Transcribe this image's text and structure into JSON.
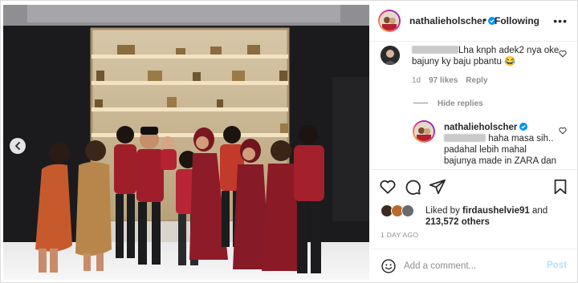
{
  "post": {
    "username": "nathalieholscher",
    "follow_separator": "•",
    "follow_label": "Following",
    "more_label": "•••"
  },
  "comments": [
    {
      "text": "Lha knph adek2 nya oke bajuny ky baju pbantu 😂",
      "meta": {
        "time": "1d",
        "likes": "97 likes",
        "reply": "Reply"
      }
    }
  ],
  "hide_replies_label": "Hide replies",
  "reply": {
    "username": "nathalieholscher",
    "text": "haha masa sih.. padahal lebih mahal bajunya made in ZARA dan"
  },
  "likes": {
    "prefix": "Liked by",
    "user": "firdaushelvie91",
    "and": "and",
    "count": "213,572 others"
  },
  "date": "1 DAY AGO",
  "add_comment": {
    "placeholder": "Add a comment...",
    "post_label": "Post"
  },
  "icons": {
    "verified": "verified-badge-icon",
    "heart": "heart-icon",
    "comment": "comment-icon",
    "share": "share-icon",
    "save": "bookmark-icon",
    "emoji": "emoji-icon",
    "prev": "chevron-left-icon"
  },
  "colors": {
    "accent": "#0095f6",
    "verified": "#0095f6",
    "muted": "#8e8e8e",
    "post_disabled": "#b2dffc"
  }
}
